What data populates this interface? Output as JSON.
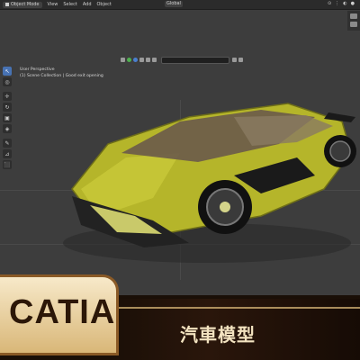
{
  "topbar": {
    "mode_label": "Object Mode",
    "menu": [
      "View",
      "Select",
      "Add",
      "Object"
    ],
    "orientation": "Global"
  },
  "viewport": {
    "perspective_label": "User Perspective",
    "collection_label": "(1) Scene Collection | Good exit opening"
  },
  "toolbar_icons": [
    "select-icon",
    "cursor-icon",
    "move-icon",
    "rotate-icon",
    "scale-icon",
    "transform-icon",
    "annotate-icon",
    "measure-icon",
    "add-cube-icon"
  ],
  "banner": {
    "brand": "CATIA",
    "subtitle": "汽車模型"
  },
  "colors": {
    "car_body": "#b5b52a",
    "badge_gold": "#d9b778",
    "accent_blue": "#4772b3"
  }
}
